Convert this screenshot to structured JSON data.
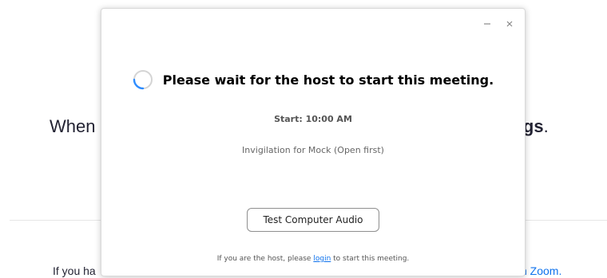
{
  "background": {
    "heading_left": "When",
    "heading_right": "tings",
    "heading_right_suffix": ".",
    "footer_left": "If you ha",
    "footer_right": "n Zoom."
  },
  "dialog": {
    "minimize_icon": "minimize-icon",
    "close_icon": "close-icon",
    "title": "Please wait for the host to start this meeting.",
    "start_time": "Start: 10:00 AM",
    "meeting_name": "Invigilation for Mock (Open first)",
    "audio_button": "Test Computer Audio",
    "host_note_before": "If you are the host, please ",
    "host_note_link": "login",
    "host_note_after": " to start this meeting."
  },
  "colors": {
    "link": "#0e72ed",
    "spinner": "#2d8cff"
  }
}
